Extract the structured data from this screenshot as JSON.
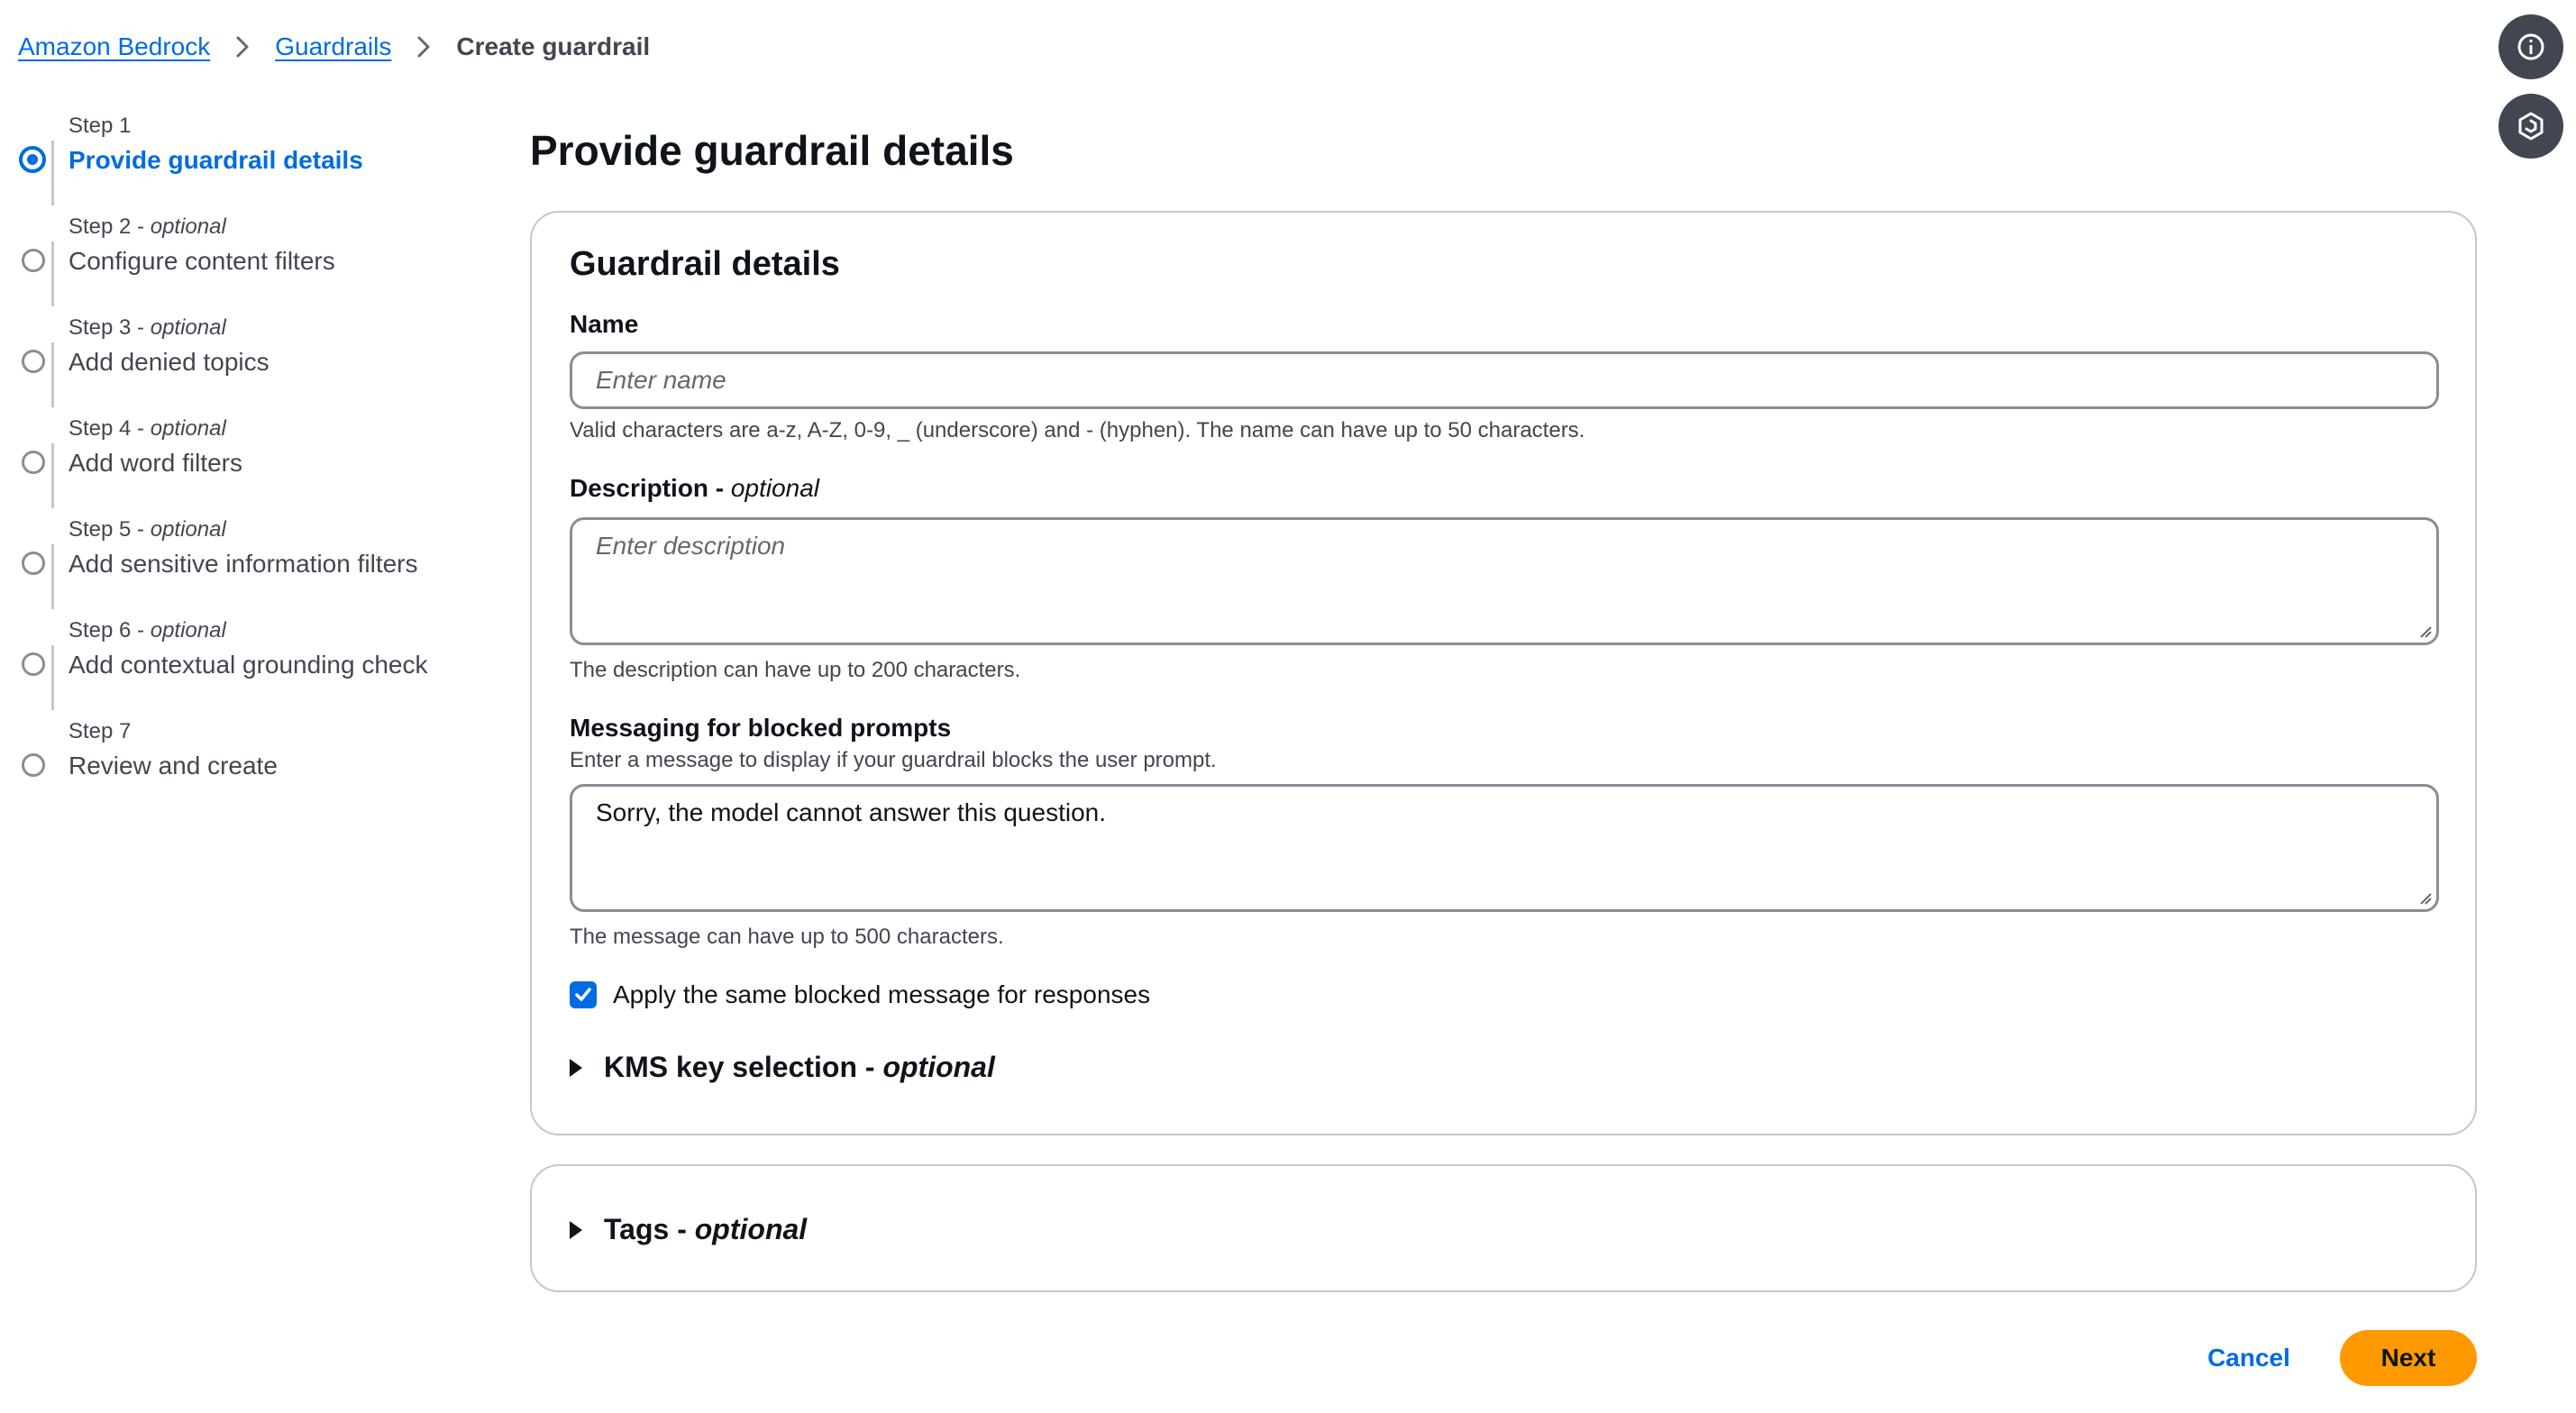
{
  "breadcrumb": {
    "items": [
      {
        "label": "Amazon Bedrock"
      },
      {
        "label": "Guardrails"
      }
    ],
    "current": "Create guardrail"
  },
  "utility": {
    "info_icon": "info-icon",
    "second_icon": "hexagon-icon"
  },
  "steps": [
    {
      "label": "Step 1",
      "optional": "",
      "title": "Provide guardrail details",
      "active": true
    },
    {
      "label": "Step 2 - ",
      "optional": "optional",
      "title": "Configure content filters",
      "active": false
    },
    {
      "label": "Step 3 - ",
      "optional": "optional",
      "title": "Add denied topics",
      "active": false
    },
    {
      "label": "Step 4 - ",
      "optional": "optional",
      "title": "Add word filters",
      "active": false
    },
    {
      "label": "Step 5 - ",
      "optional": "optional",
      "title": "Add sensitive information filters",
      "active": false
    },
    {
      "label": "Step 6 - ",
      "optional": "optional",
      "title": "Add contextual grounding check",
      "active": false
    },
    {
      "label": "Step 7",
      "optional": "",
      "title": "Review and create",
      "active": false
    }
  ],
  "page": {
    "title": "Provide guardrail details"
  },
  "details": {
    "title": "Guardrail details",
    "name": {
      "label": "Name",
      "placeholder": "Enter name",
      "value": "",
      "hint": "Valid characters are a-z, A-Z, 0-9, _ (underscore) and - (hyphen). The name can have up to 50 characters."
    },
    "description": {
      "label": "Description - ",
      "optional": "optional",
      "placeholder": "Enter description",
      "value": "",
      "hint": "The description can have up to 200 characters."
    },
    "blocked_prompts": {
      "label": "Messaging for blocked prompts",
      "desc": "Enter a message to display if your guardrail blocks the user prompt.",
      "value": "Sorry, the model cannot answer this question.",
      "hint": "The message can have up to 500 characters."
    },
    "apply_same": {
      "label": "Apply the same blocked message for responses",
      "checked": true
    },
    "kms": {
      "title": "KMS key selection - ",
      "optional": "optional"
    }
  },
  "tags": {
    "title": "Tags - ",
    "optional": "optional"
  },
  "actions": {
    "cancel": "Cancel",
    "next": "Next"
  },
  "colors": {
    "accent": "#006ce0",
    "primary_button": "#ff9900",
    "text": "#0f141a",
    "secondary_text": "#424650"
  }
}
